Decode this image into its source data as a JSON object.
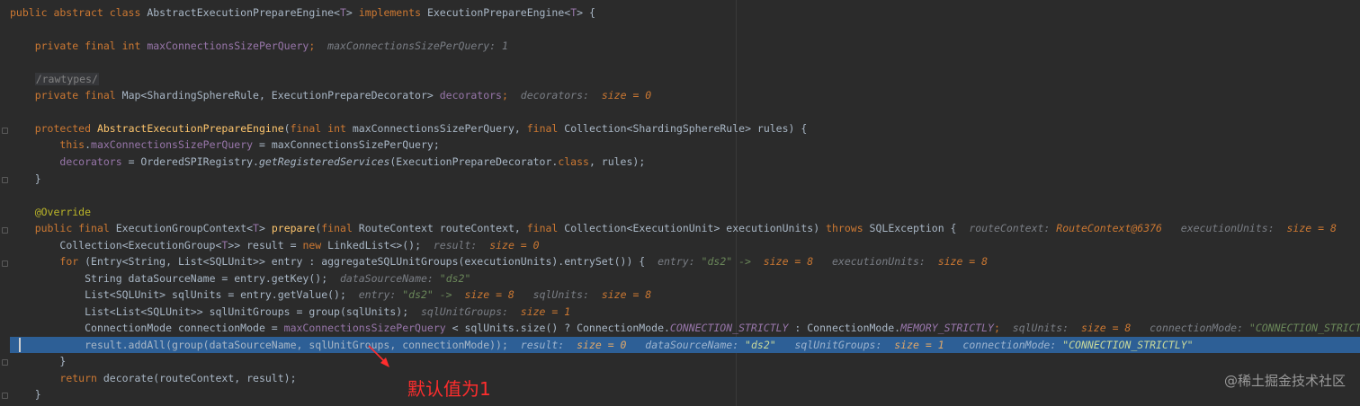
{
  "code": {
    "l1": {
      "a": "public abstract class ",
      "b": "AbstractExecutionPrepareEngine<",
      "c": "T",
      "d": "> ",
      "e": "implements ",
      "f": "ExecutionPrepareEngine<",
      "g": "T",
      "h": "> {"
    },
    "l2": {
      "a": "private final int ",
      "b": "maxConnectionsSizePerQuery",
      "c": ";",
      "h1": "maxConnectionsSizePerQuery: 1"
    },
    "l3": {
      "a": "/rawtypes/"
    },
    "l4": {
      "a": "private final ",
      "b": "Map<ShardingSphereRule, ExecutionPrepareDecorator> ",
      "c": "decorators",
      ";": ";",
      "h1": "decorators: ",
      "h2": "size = 0"
    },
    "l5": {
      "a": "protected ",
      "b": "AbstractExecutionPrepareEngine",
      "c": "(",
      "d": "final int ",
      "e": "maxConnectionsSizePerQuery, ",
      "f": "final ",
      "g": "Collection<ShardingSphereRule> rules) {"
    },
    "l6": {
      "a": "this",
      ".": ".",
      "b": "maxConnectionsSizePerQuery",
      " ": " = maxConnectionsSizePerQuery;"
    },
    "l7": {
      "a": "decorators",
      " ": " = OrderedSPIRegistry.",
      "b": "getRegisteredServices",
      "c": "(ExecutionPrepareDecorator.",
      "d": "class",
      ",": ", rules);"
    },
    "l8": {
      "a": "}"
    },
    "l9": {
      "a": "@Override"
    },
    "l10": {
      "a": "public final ",
      "b": "ExecutionGroupContext<",
      "c": "T",
      "d": "> ",
      "e": "prepare",
      "f": "(",
      "g": "final ",
      "h": "RouteContext routeContext, ",
      "i": "final ",
      "j": "Collection<ExecutionUnit> executionUnits) ",
      "k": "throws ",
      "l": "SQLException {",
      "h1": "routeContext: ",
      "h2": "RouteContext@6376",
      "h3": "executionUnits: ",
      "h4": "size = 8"
    },
    "l11": {
      "a": "Collection<ExecutionGroup<",
      "b": "T",
      ">>": ">> result = ",
      "c": "new ",
      "d": "LinkedList<>();",
      "h1": "result: ",
      "h2": "size = 0"
    },
    "l12": {
      "a": "for ",
      "b": "(Entry<String, List<SQLUnit>> entry : aggregateSQLUnitGroups(executionUnits).entrySet()) {",
      "h1": "entry: ",
      "h2": "\"ds2\" -> ",
      "h3": "size = 8",
      "h4": "executionUnits: ",
      "h5": "size = 8"
    },
    "l13": {
      "a": "String dataSourceName = entry.getKey();",
      "h1": "dataSourceName: ",
      "h2": "\"ds2\""
    },
    "l14": {
      "a": "List<SQLUnit> sqlUnits = entry.getValue();",
      "h1": "entry: ",
      "h2": "\"ds2\" -> ",
      "h3": "size = 8",
      "h4": "sqlUnits: ",
      "h5": "size = 8"
    },
    "l15": {
      "a": "List<List<SQLUnit>> sqlUnitGroups = group(sqlUnits);",
      "h1": "sqlUnitGroups: ",
      "h2": "size = 1"
    },
    "l16": {
      "a": "ConnectionMode connectionMode = ",
      "b": "maxConnectionsSizePerQuery",
      " ": " < sqlUnits.size() ? ConnectionMode.",
      "c": "CONNECTION_STRICTLY",
      "d": " : ConnectionMode.",
      "e": "MEMORY_STRICTLY",
      ";": ";",
      "h1": "sqlUnits: ",
      "h2": "size = 8",
      "h3": "connectionMode: ",
      "h4": "\"CONNECTION_STRICTLY\""
    },
    "l17": {
      "a": "result.addAll(group(dataSourceName, sqlUnitGroups, connectionMode));",
      "h1": "result: ",
      "h2": "size = 0",
      "h3": "dataSourceName: ",
      "h4": "\"ds2\"",
      "h5": "sqlUnitGroups: ",
      "h6": "size = 1",
      "h7": "connectionMode: ",
      "h8": "\"CONNECTION_STRICTLY\""
    },
    "l18": {
      "a": "}"
    },
    "l19": {
      "a": "return ",
      "b": "decorate(routeContext, result);"
    },
    "l20": {
      "a": "}"
    }
  },
  "annotation": "默认值为1",
  "watermark": "@稀土掘金技术社区",
  "colors": {
    "background": "#2b2b2b",
    "execution_line": "#2d5f96",
    "keyword": "#cc7832",
    "field": "#9876aa",
    "method": "#ffc66d",
    "string": "#6a8759",
    "annotation_text": "#ff2d2d"
  }
}
